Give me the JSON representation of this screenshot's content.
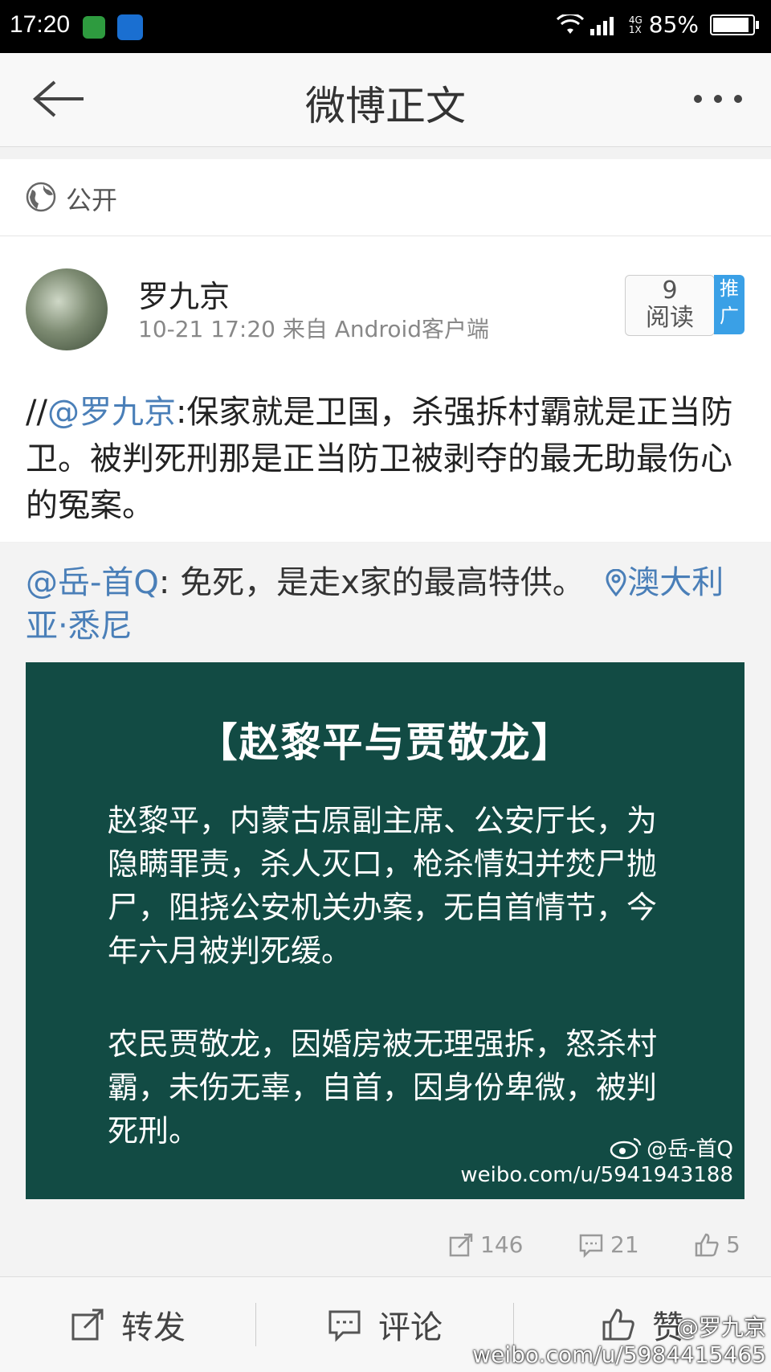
{
  "status": {
    "time": "17:20",
    "network": "4G\n1X",
    "battery": "85%"
  },
  "header": {
    "title": "微博正文"
  },
  "visibility": {
    "label": "公开"
  },
  "post": {
    "author": "罗九京",
    "meta": "10-21 17:20  来自 Android客户端",
    "read_count": "9",
    "read_label": "阅读",
    "promote_label": "推广",
    "text_prefix": "//",
    "mention": "@罗九京",
    "text_body": ":保家就是卫国，杀强拆村霸就是正当防卫。被判死刑那是正当防卫被剥夺的最无助最伤心的冤案。"
  },
  "repost": {
    "author_mention": "@岳-首Q",
    "text": ": 免死，是走x家的最高特供。",
    "location": "澳大利亚·悉尼",
    "image": {
      "title": "【赵黎平与贾敬龙】",
      "paragraph1": "赵黎平，内蒙古原副主席、公安厅长，为隐瞒罪责，杀人灭口，枪杀情妇并焚尸抛尸，阻挠公安机关办案，无自首情节，今年六月被判死缓。",
      "paragraph2": "农民贾敬龙，因婚房被无理强拆，怒杀村霸，未伤无辜，自首，因身份卑微，被判死刑。",
      "watermark_user": "@岳-首Q",
      "watermark_url": "weibo.com/u/5941943188"
    },
    "stats": {
      "reposts": "146",
      "comments": "21",
      "likes": "5"
    }
  },
  "bottom_bar": {
    "repost": "转发",
    "comment": "评论",
    "like": "赞"
  },
  "watermark": {
    "user": "@罗九京",
    "url": "weibo.com/u/5984415465"
  },
  "colors": {
    "link": "#4a7fb8",
    "image_bg": "#124b44",
    "promote": "#3aa0e6"
  }
}
